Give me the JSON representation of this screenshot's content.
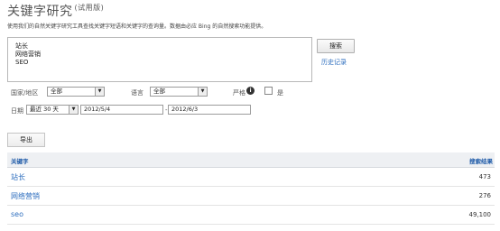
{
  "header": {
    "title": "关键字研究",
    "trial_label": "(试用版)",
    "description": "使用我们的自然关键字研究工具查找关键字短语和关键字的查询量。数据由必应 Bing 的自然搜索功能提供。"
  },
  "keywords_box": {
    "lines": [
      "站长",
      "网络营销",
      "SEO"
    ]
  },
  "actions": {
    "search_label": "搜索",
    "history_label": "历史记录",
    "export_label": "导出"
  },
  "filters": {
    "country_label": "国家/地区",
    "country_value": "全部",
    "language_label": "语言",
    "language_value": "全部",
    "strict_label": "严格",
    "strict_option": "是",
    "strict_checked": false,
    "date_label": "日期",
    "date_range_value": "最近 30 天",
    "date_start": "2012/5/4",
    "date_separator": "-",
    "date_end": "2012/6/3"
  },
  "table": {
    "col_keyword": "关键字",
    "col_count": "搜索结果",
    "rows": [
      {
        "keyword": "站长",
        "count": "473"
      },
      {
        "keyword": "网络营销",
        "count": "276"
      },
      {
        "keyword": "seo",
        "count": "49,100"
      }
    ]
  }
}
